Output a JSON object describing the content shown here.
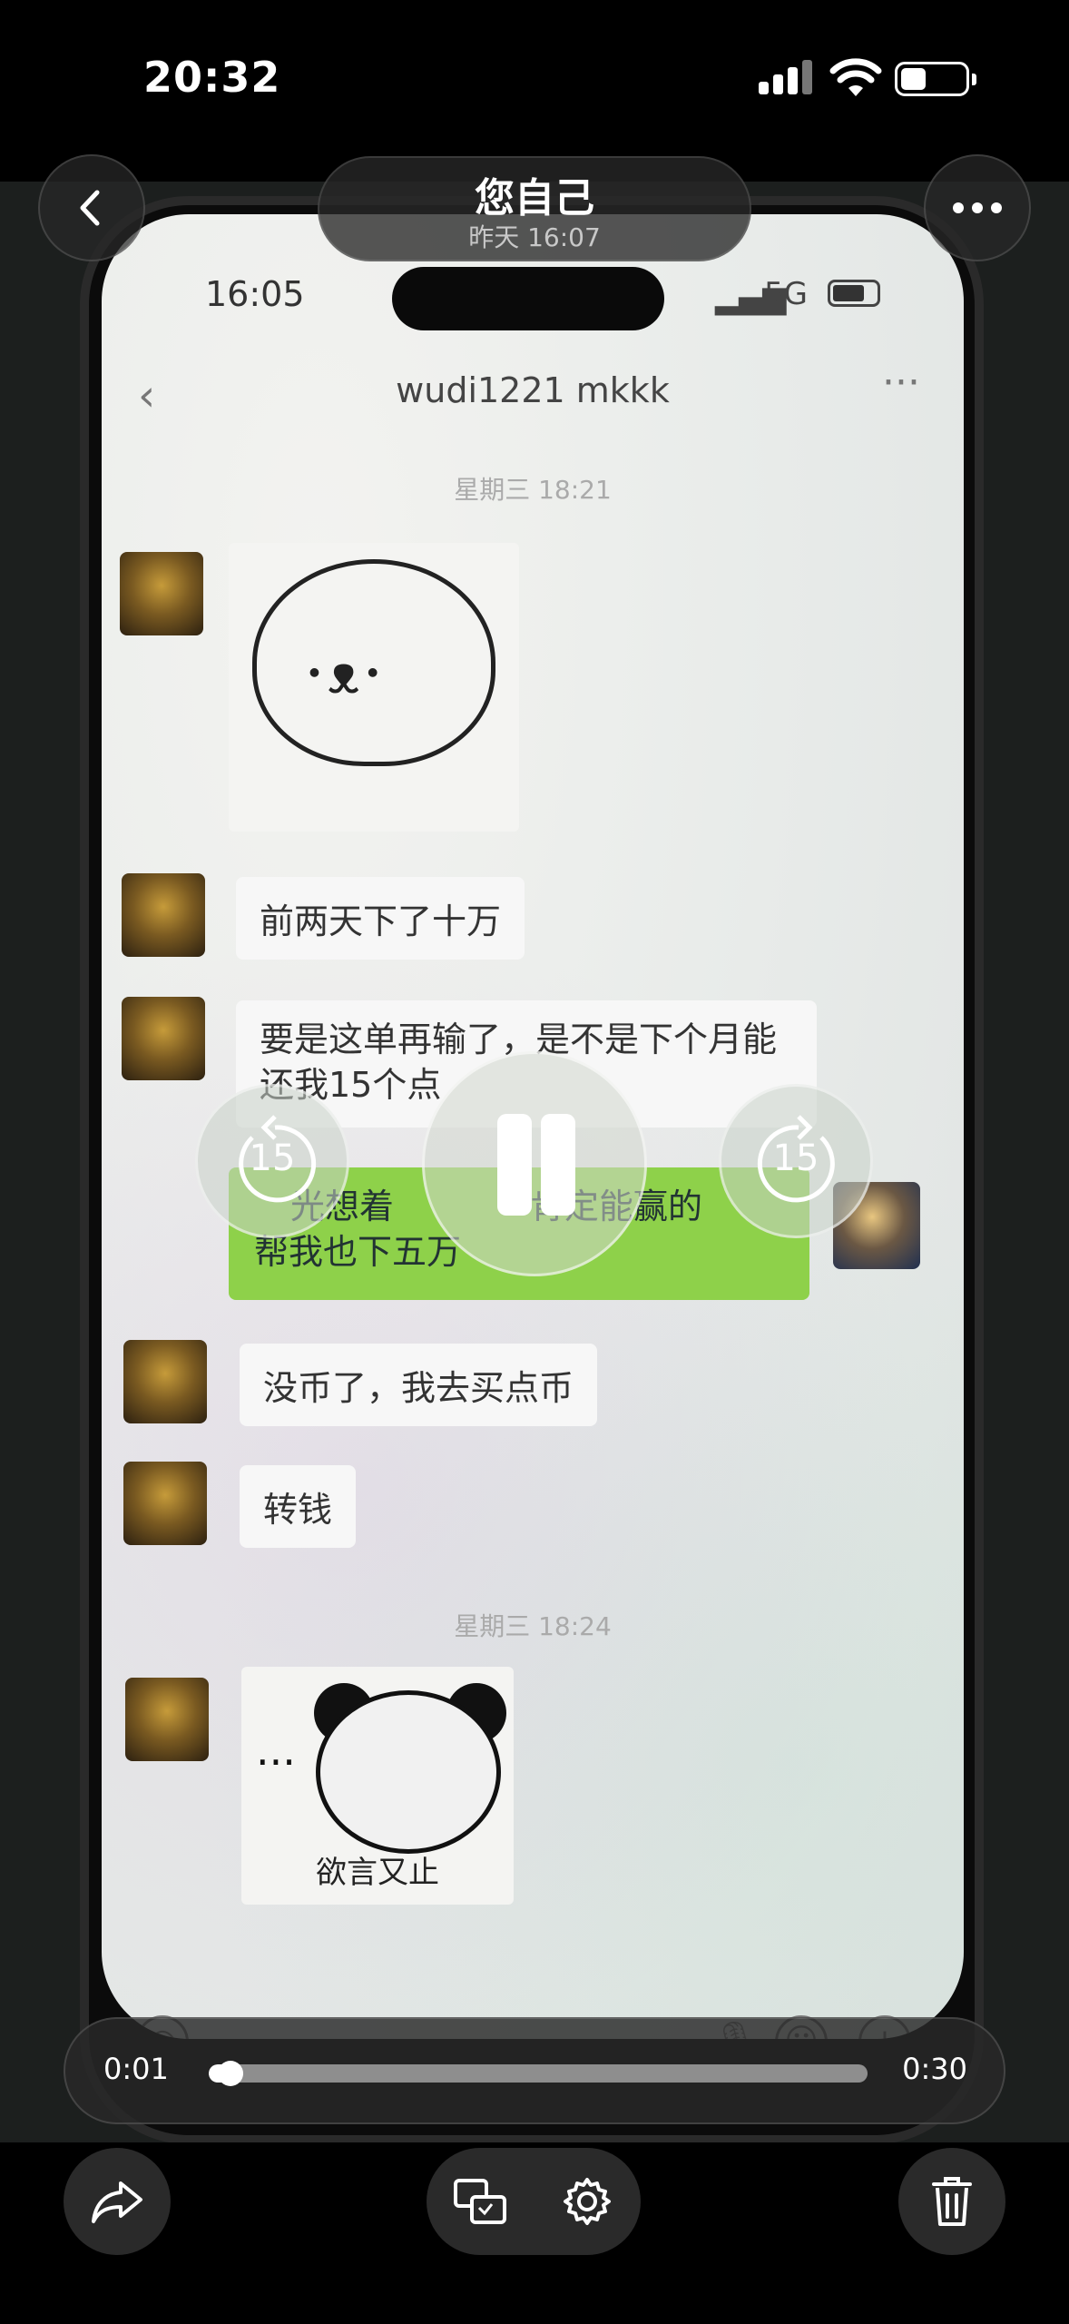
{
  "status_bar": {
    "time": "20:32",
    "battery_level": 0.4
  },
  "header": {
    "title": "您自己",
    "subtitle": "昨天 16:07",
    "back_icon": "chevron-left-icon",
    "more_icon": "more-horizontal-icon"
  },
  "video_content": {
    "phone_time": "16:05",
    "phone_network": "5G",
    "chat_title": "wudi1221 mkkk",
    "dates": [
      "星期三 18:21",
      "星期三 18:24"
    ],
    "messages": [
      {
        "text": "前两天下了十万"
      },
      {
        "text": "要是这单再输了，是不是下个月能"
      },
      {
        "text": "还我15个点"
      },
      {
        "text": "光想着",
        "text2": "肯定能赢的"
      },
      {
        "text": "帮我也下五万"
      },
      {
        "text": "没币了，我去买点币"
      },
      {
        "text": "转钱"
      }
    ],
    "sticker_caption": "欲言又止"
  },
  "playback": {
    "rewind_seconds": "15",
    "forward_seconds": "15",
    "state": "playing",
    "current_time": "0:01",
    "duration": "0:30",
    "progress": 0.033
  },
  "toolbar": {
    "share_icon": "share-icon",
    "live_text_icon": "live-text-icon",
    "settings_icon": "gear-icon",
    "delete_icon": "trash-icon"
  },
  "colors": {
    "accent_green": "#8ed14a",
    "overlay_bg": "#282828"
  }
}
